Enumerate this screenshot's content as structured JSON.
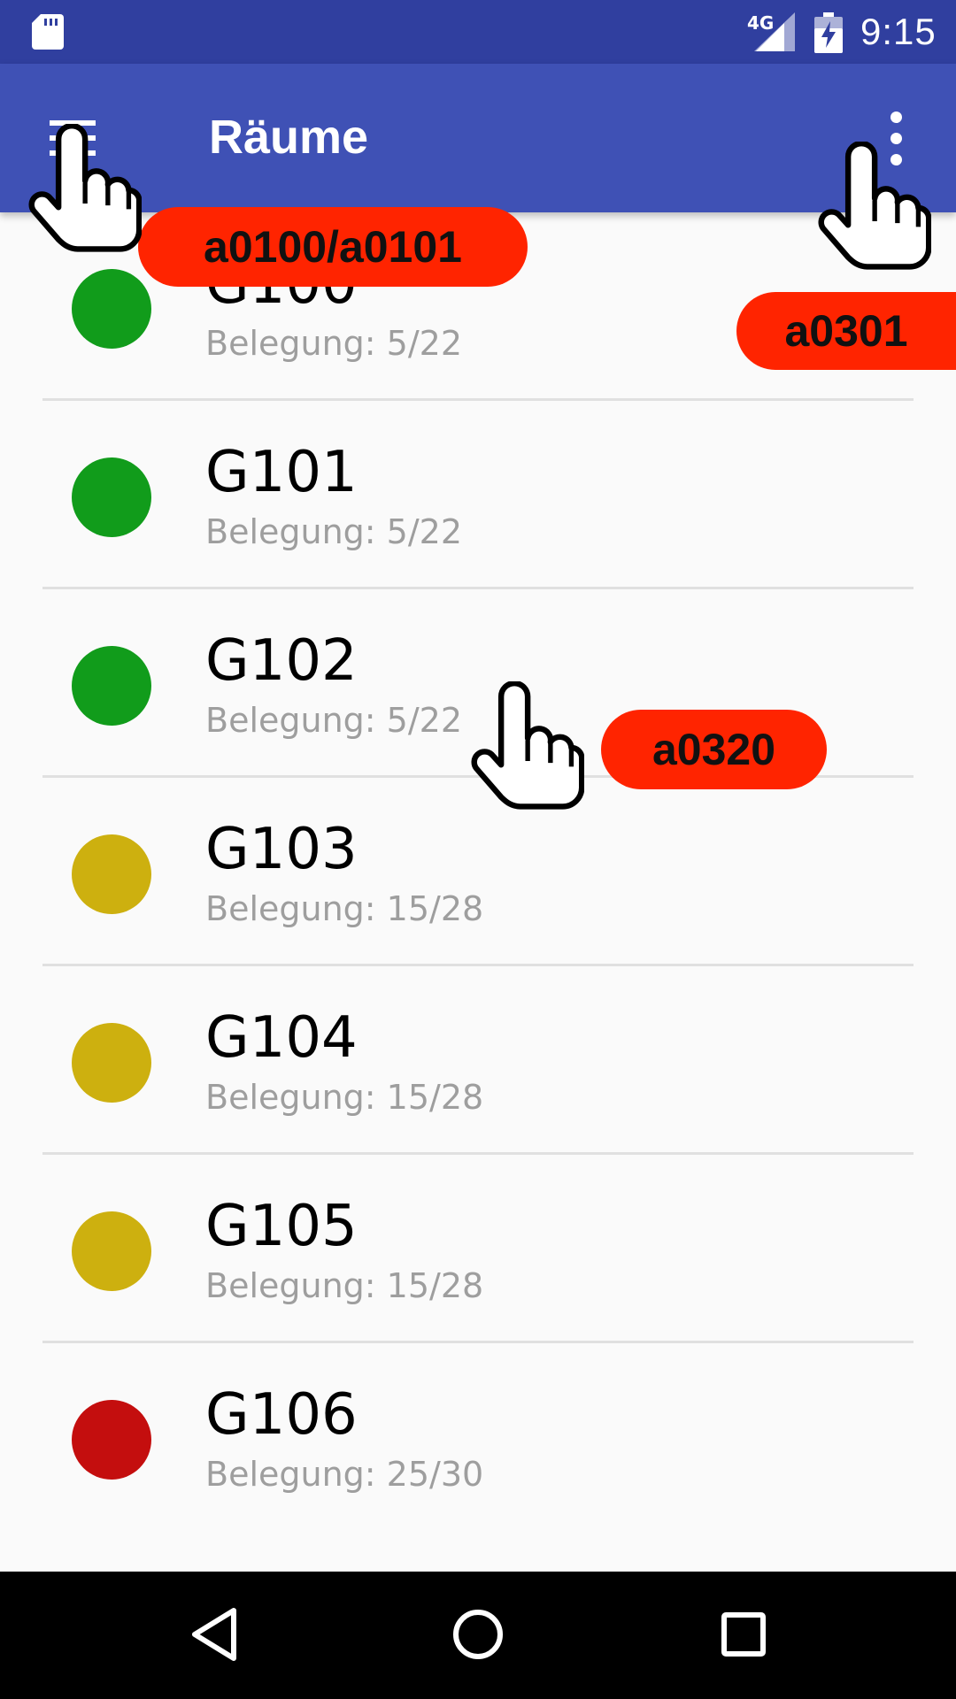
{
  "status_bar": {
    "network_type": "4G",
    "time": "9:15",
    "icons": [
      "sd-card-icon",
      "signal-icon",
      "battery-charging-icon"
    ]
  },
  "app_bar": {
    "title": "Räume",
    "menu_icon": "hamburger-menu-icon",
    "overflow_icon": "more-vert-icon"
  },
  "rooms": [
    {
      "name": "G100",
      "occupancy": "Belegung: 5/22",
      "status_color": "#119c1b"
    },
    {
      "name": "G101",
      "occupancy": "Belegung: 5/22",
      "status_color": "#119c1b"
    },
    {
      "name": "G102",
      "occupancy": "Belegung: 5/22",
      "status_color": "#119c1b"
    },
    {
      "name": "G103",
      "occupancy": "Belegung: 15/28",
      "status_color": "#cdb00f"
    },
    {
      "name": "G104",
      "occupancy": "Belegung: 15/28",
      "status_color": "#cdb00f"
    },
    {
      "name": "G105",
      "occupancy": "Belegung: 15/28",
      "status_color": "#cdb00f"
    },
    {
      "name": "G106",
      "occupancy": "Belegung: 25/30",
      "status_color": "#c40e0e"
    }
  ],
  "annotations": {
    "menu_tag": "a0100/a0101",
    "overflow_tag": "a0301",
    "item_tag": "a0320"
  },
  "nav_bar": {
    "icons": [
      "back-icon",
      "home-icon",
      "recents-icon"
    ]
  },
  "colors": {
    "primary": "#3f51b5",
    "primary_dark": "#303f9f",
    "annotation": "#ff2400"
  }
}
